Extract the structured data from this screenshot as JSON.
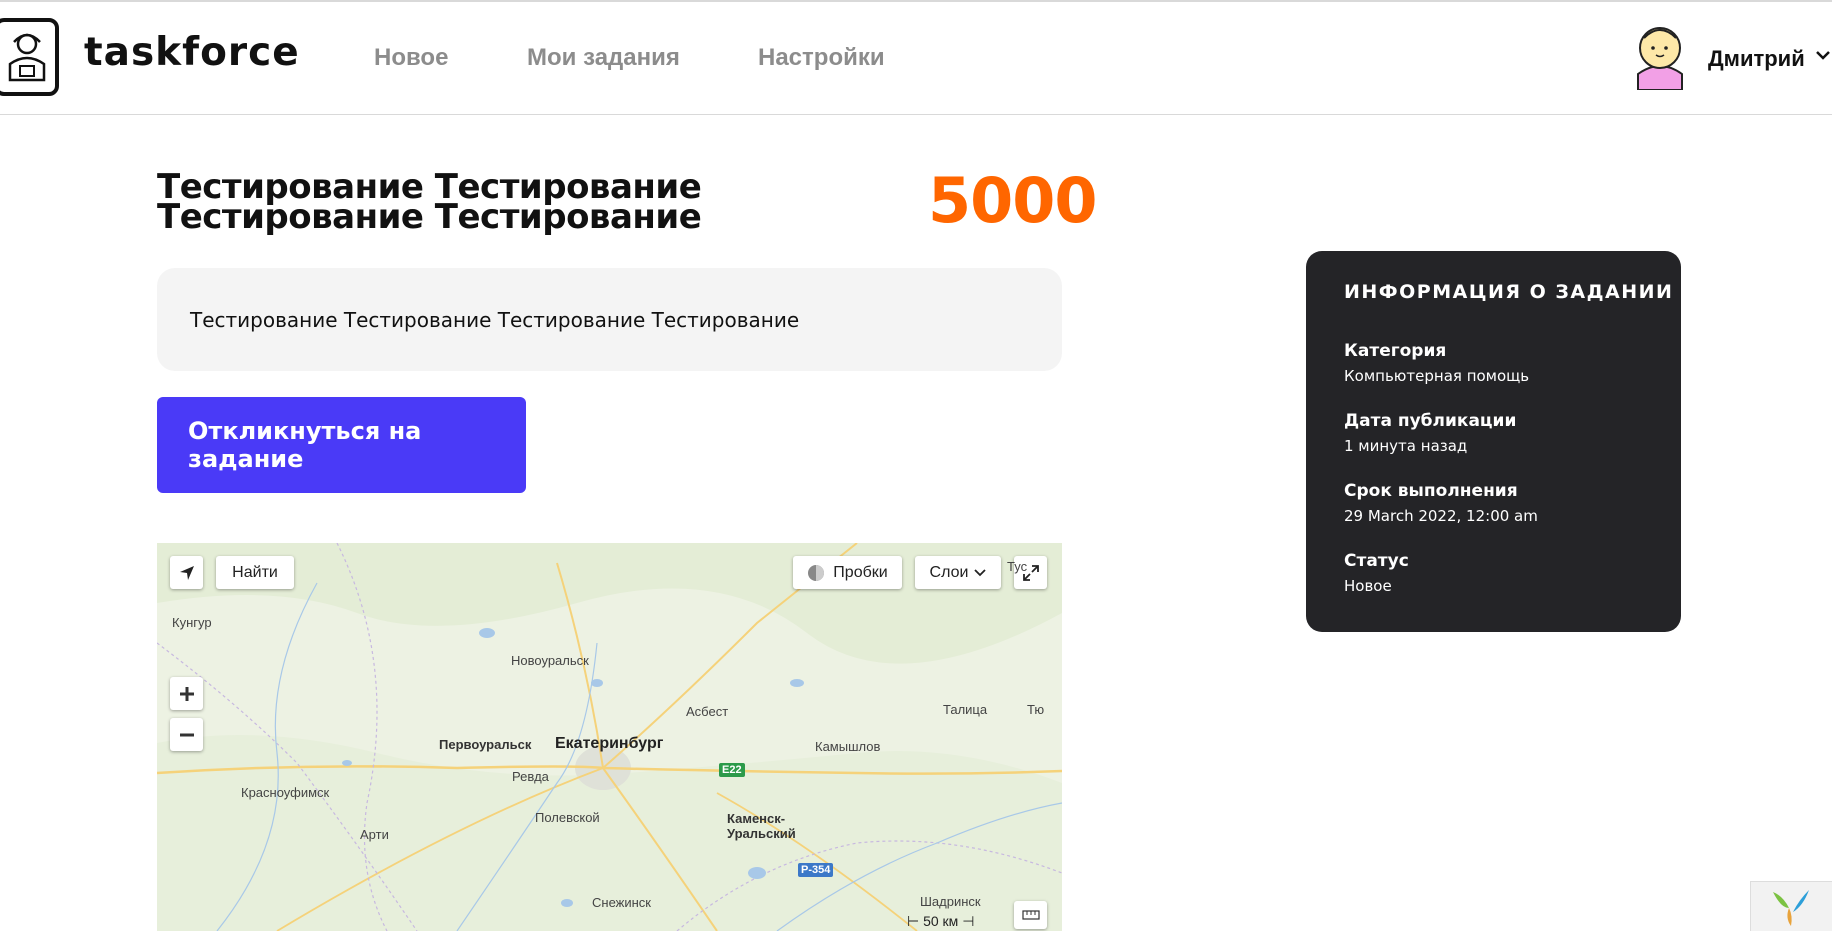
{
  "header": {
    "brand": "taskforce",
    "nav": [
      {
        "label": "Новое"
      },
      {
        "label": "Мои задания"
      },
      {
        "label": "Настройки"
      }
    ],
    "user": {
      "name": "Дмитрий"
    }
  },
  "task": {
    "title": "Тестирование Тестирование Тестирование Тестирование",
    "price": "5000",
    "description": "Тестирование Тестирование Тестирование Тестирование",
    "respond_label": "Откликнуться на задание"
  },
  "map": {
    "find_label": "Найти",
    "traffic_label": "Пробки",
    "layers_label": "Слои",
    "scale_label": "50 км",
    "cities": {
      "kungur": "Кунгур",
      "novouralsk": "Новоуральск",
      "asbest": "Асбест",
      "talitsa": "Талица",
      "pervouralsk": "Первоуральск",
      "ekaterinburg": "Екатеринбург",
      "kamyshlov": "Камышлов",
      "revda": "Ревда",
      "krasnoufimsk": "Красноуфимск",
      "polevskoy": "Полевской",
      "kamensk": "Каменск-\nУральский",
      "arti": "Арти",
      "snezhinsk": "Снежинск",
      "shadrinsk": "Шадринск",
      "tyu": "Тю",
      "tug": "Тус"
    },
    "roads": {
      "e22": "E22",
      "p354": "Р-354"
    }
  },
  "info": {
    "title": "ИНФОРМАЦИЯ О ЗАДАНИИ",
    "category_label": "Категория",
    "category_value": "Компьютерная помощь",
    "published_label": "Дата публикации",
    "published_value": "1 минута назад",
    "deadline_label": "Срок выполнения",
    "deadline_value": "29 March 2022, 12:00 am",
    "status_label": "Статус",
    "status_value": "Новое"
  },
  "colors": {
    "accent": "#4a3af7",
    "price": "#ff6600",
    "card_bg": "#242427",
    "desc_bg": "#f4f4f4",
    "nav_gray": "#8c8c8c"
  }
}
